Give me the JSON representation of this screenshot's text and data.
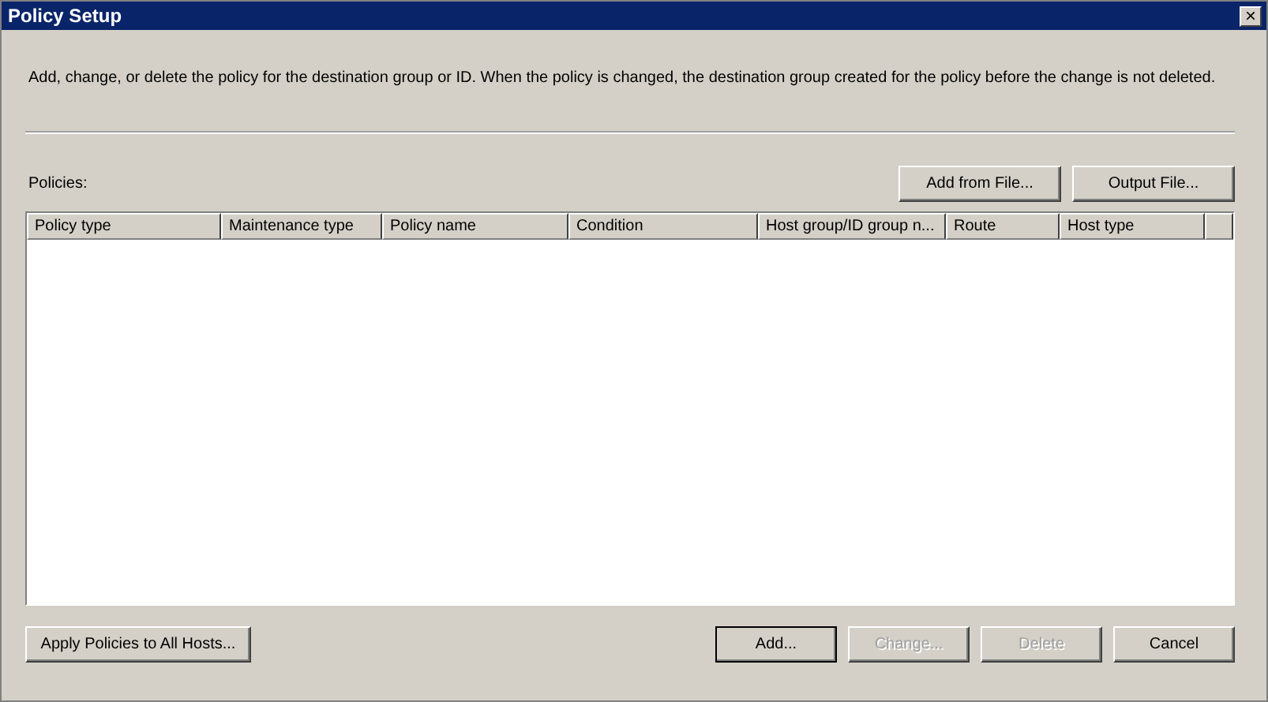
{
  "window": {
    "title": "Policy Setup",
    "close": "×"
  },
  "description": "Add, change, or delete the policy for the destination group or ID. When the policy is changed, the destination group created for the policy before the change is not deleted.",
  "policies_label": "Policies:",
  "top_buttons": [
    {
      "label": "Add from File...",
      "disabled": false
    },
    {
      "label": "Output File...",
      "disabled": false
    }
  ],
  "table": {
    "columns": [
      "Policy type",
      "Maintenance type",
      "Policy name",
      "Condition",
      "Host group/ID group n...",
      "Route",
      "Host type"
    ]
  },
  "apply_button": {
    "label": "Apply Policies to All Hosts...",
    "disabled": false
  },
  "bottom_buttons": [
    {
      "label": "Add...",
      "disabled": false,
      "default": true
    },
    {
      "label": "Change...",
      "disabled": true,
      "default": false
    },
    {
      "label": "Delete",
      "disabled": true,
      "default": false
    },
    {
      "label": "Cancel",
      "disabled": false,
      "default": false
    }
  ]
}
